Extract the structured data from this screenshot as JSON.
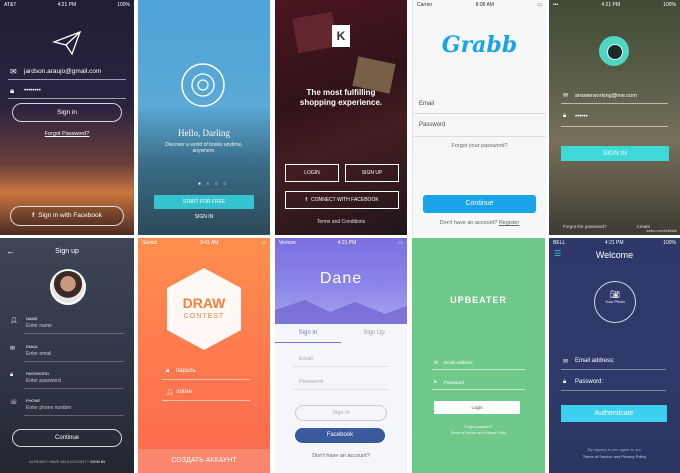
{
  "s1": {
    "status": {
      "carrier": "AT&T",
      "time": "4:21 PM",
      "battery": "100%"
    },
    "email": "jardson.araujo@gmail.com",
    "password": "••••••••",
    "sign_in": "Sign in",
    "forgot": "Forgot Password?",
    "facebook": "Sign in with Facebook",
    "fb_icon": "f"
  },
  "s2": {
    "title": "Hello, Darling",
    "subtitle": "Discover a world of books anytime, anywhere.",
    "start": "START FOR FREE",
    "signin": "SIGN IN"
  },
  "s3": {
    "logo": "K",
    "headline": "The most fulfilling shopping experience.",
    "login": "LOGIN",
    "signup": "SIGN UP",
    "facebook": "CONNECT WITH FACEBOOK",
    "fb_icon": "f",
    "terms": "Terms and Conditions"
  },
  "s4": {
    "status": {
      "carrier": "Carrier",
      "time": "8:08 AM"
    },
    "logo": "Grabb",
    "email_label": "Email",
    "password_label": "Password",
    "forgot": "Forgot your password?",
    "continue": "Continue",
    "no_account": "Don't have an account?",
    "register": "Register"
  },
  "s5": {
    "status": {
      "time": "4:21 PM",
      "battery": "100%"
    },
    "email": "answerworking@me.com",
    "password": "••••••",
    "sign_in": "SIGN IN",
    "forgot": "Forgot the password?",
    "create": "Create",
    "watermark": "weibo.com/Dribbble"
  },
  "s6": {
    "back": "←",
    "title": "Sign up",
    "name_label": "NAME",
    "name_ph": "Enter name",
    "email_label": "EMAIL",
    "email_ph": "Enter email",
    "password_label": "PASSWORD",
    "password_ph": "Enter password",
    "phone_label": "PHONE",
    "phone_ph": "Enter phone number",
    "continue": "Continue",
    "already": "ALREADY HAVE AN ACCOUNT?",
    "sign_in": "SIGN IN"
  },
  "s7": {
    "status": {
      "carrier": "Sketch",
      "time": "9:41 AM"
    },
    "title": "DRAW",
    "subtitle": "CONTEST",
    "password_ph": "пароль",
    "login_ph": "логин",
    "create": "СОЗДАТЬ АККАУНТ"
  },
  "s8": {
    "status": {
      "carrier": "Verizon",
      "time": "4:21 PM"
    },
    "logo": "Dane",
    "tab_signin": "Sign In",
    "tab_signup": "Sign Up",
    "email_ph": "Email",
    "password_ph": "Password",
    "signin_btn": "Sign In",
    "facebook": "Facebook",
    "no_account": "Don't have an account?"
  },
  "s9": {
    "logo": "UPBEATER",
    "email_ph": "Email address",
    "password_ph": "Password",
    "login": "Login",
    "forgot": "Forgot password?",
    "terms": "Terms of Service and Privacy Policy"
  },
  "s10": {
    "status": {
      "carrier": "BELL",
      "time": "4:21 PM",
      "battery": "100%"
    },
    "title": "Welcome",
    "photo": "Your Photo",
    "email_label": "Email address:",
    "password_label": "Password:",
    "authenticate": "Authenticate",
    "agree": "By signing in you agree to our",
    "terms": "Terms of Service and Privacy Policy"
  },
  "colors": {
    "grabb": "#1aa3e8",
    "teal": "#3ed8d6",
    "dane_purple": "#7a7ee6",
    "upbeater_green": "#6fc98b",
    "welcome_bg": "#2f3a6b",
    "auth": "#3dcfee"
  }
}
